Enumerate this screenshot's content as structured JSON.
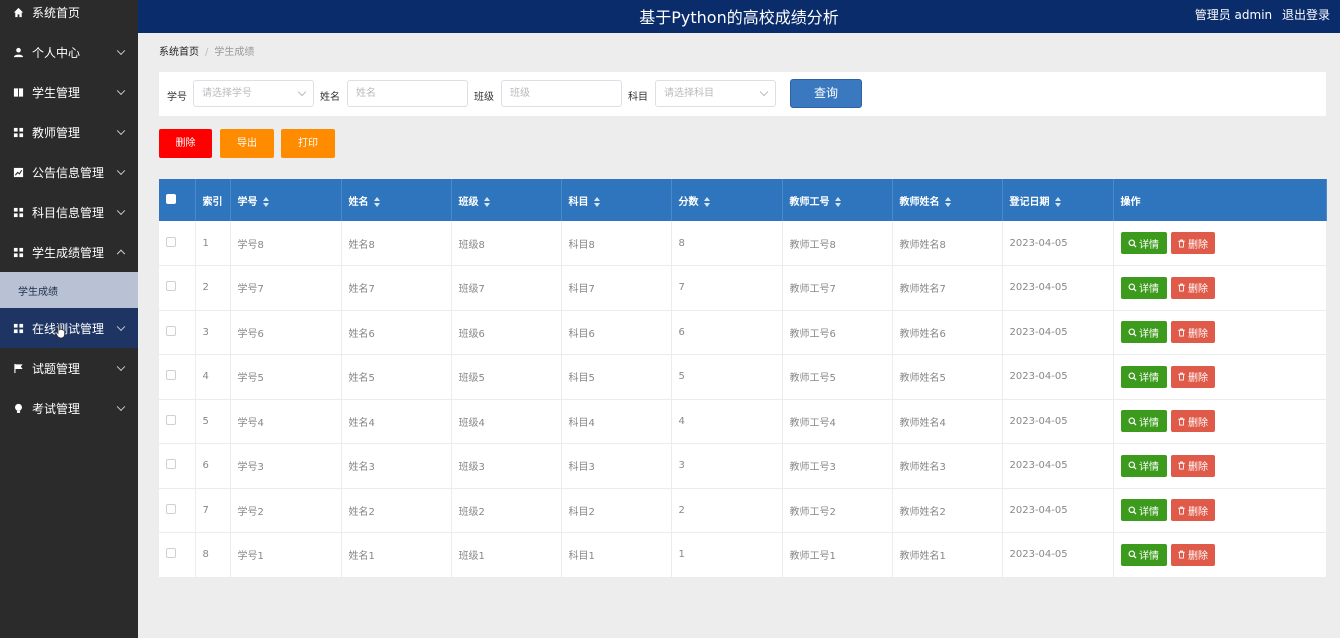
{
  "header": {
    "title": "基于Python的高校成绩分析",
    "user": "管理员 admin",
    "logout": "退出登录"
  },
  "sidebar": {
    "items": [
      {
        "label": "系统首页",
        "icon": "home-icon"
      },
      {
        "label": "个人中心",
        "icon": "person-icon"
      },
      {
        "label": "学生管理",
        "icon": "book-icon"
      },
      {
        "label": "教师管理",
        "icon": "grid-icon"
      },
      {
        "label": "公告信息管理",
        "icon": "chart-icon"
      },
      {
        "label": "科目信息管理",
        "icon": "grid-icon"
      },
      {
        "label": "学生成绩管理",
        "icon": "grid-icon"
      },
      {
        "label": "在线测试管理",
        "icon": "grid-icon"
      },
      {
        "label": "试题管理",
        "icon": "flag-icon"
      },
      {
        "label": "考试管理",
        "icon": "bulb-icon"
      }
    ],
    "submenu": "学生成绩"
  },
  "breadcrumb": {
    "home": "系统首页",
    "current": "学生成绩"
  },
  "search": {
    "id_label": "学号",
    "id_placeholder": "请选择学号",
    "name_label": "姓名",
    "name_placeholder": "姓名",
    "class_label": "班级",
    "class_placeholder": "班级",
    "subject_label": "科目",
    "subject_placeholder": "请选择科目",
    "query": "查询"
  },
  "actions": {
    "delete": "删除",
    "export": "导出",
    "print": "打印"
  },
  "table": {
    "columns": [
      "索引",
      "学号",
      "姓名",
      "班级",
      "科目",
      "分数",
      "教师工号",
      "教师姓名",
      "登记日期",
      "操作"
    ],
    "rows": [
      [
        "1",
        "学号8",
        "姓名8",
        "班级8",
        "科目8",
        "8",
        "教师工号8",
        "教师姓名8",
        "2023-04-05"
      ],
      [
        "2",
        "学号7",
        "姓名7",
        "班级7",
        "科目7",
        "7",
        "教师工号7",
        "教师姓名7",
        "2023-04-05"
      ],
      [
        "3",
        "学号6",
        "姓名6",
        "班级6",
        "科目6",
        "6",
        "教师工号6",
        "教师姓名6",
        "2023-04-05"
      ],
      [
        "4",
        "学号5",
        "姓名5",
        "班级5",
        "科目5",
        "5",
        "教师工号5",
        "教师姓名5",
        "2023-04-05"
      ],
      [
        "5",
        "学号4",
        "姓名4",
        "班级4",
        "科目4",
        "4",
        "教师工号4",
        "教师姓名4",
        "2023-04-05"
      ],
      [
        "6",
        "学号3",
        "姓名3",
        "班级3",
        "科目3",
        "3",
        "教师工号3",
        "教师姓名3",
        "2023-04-05"
      ],
      [
        "7",
        "学号2",
        "姓名2",
        "班级2",
        "科目2",
        "2",
        "教师工号2",
        "教师姓名2",
        "2023-04-05"
      ],
      [
        "8",
        "学号1",
        "姓名1",
        "班级1",
        "科目1",
        "1",
        "教师工号1",
        "教师姓名1",
        "2023-04-05"
      ]
    ],
    "detail_label": "详情",
    "delete_label": "删除"
  },
  "colors": {
    "header": "#0a2c6b",
    "sidebar": "#2b2b2b",
    "table_head": "#2f75bd",
    "query": "#3a79bf",
    "danger": "#ff0000",
    "warning": "#ff8c00",
    "success": "#3c9a1d"
  }
}
